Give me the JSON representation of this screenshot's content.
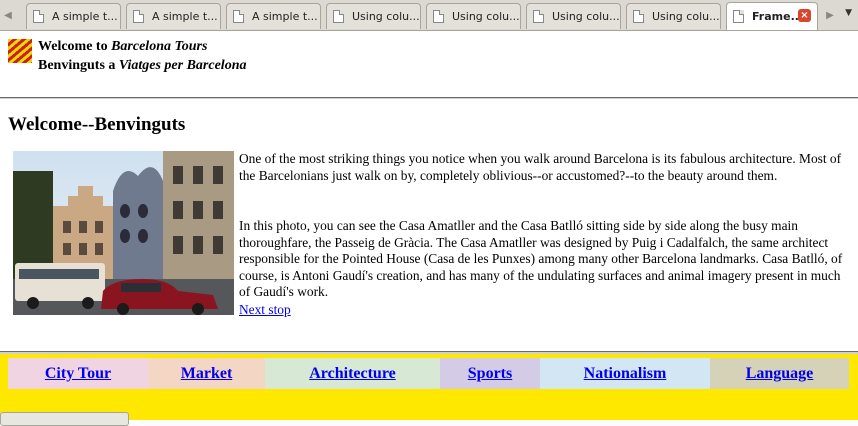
{
  "browser": {
    "tabs": [
      {
        "title": "A simple t...",
        "active": false
      },
      {
        "title": "A simple t...",
        "active": false
      },
      {
        "title": "A simple t...",
        "active": false
      },
      {
        "title": "Using colu...",
        "active": false
      },
      {
        "title": "Using colu...",
        "active": false
      },
      {
        "title": "Using colu...",
        "active": false
      },
      {
        "title": "Using colu...",
        "active": false
      },
      {
        "title": "Frame...",
        "active": true
      }
    ],
    "close_glyph": "×",
    "scroll_left_glyph": "◀",
    "scroll_right_glyph": "▶",
    "dropdown_glyph": "▼"
  },
  "header": {
    "line1_prefix": "Welcome to ",
    "line1_em": "Barcelona Tours",
    "line2_prefix": "Benvinguts a ",
    "line2_em": "Viatges per Barcelona"
  },
  "main": {
    "title": "Welcome--Benvinguts",
    "para1": "One of the most striking things you notice when you walk around Barcelona is its fabulous architecture. Most of the Barcelonians just walk on by, completely oblivious--or accustomed?--to the beauty around them.",
    "para2": "In this photo, you can see the Casa Amatller and the Casa Batlló sitting side by side along the busy main thoroughfare, the Passeig de Gràcia. The Casa Amatller was designed by Puig i Cadalfalch, the same architect responsible for the Pointed House (Casa de les Punxes) among many other Barcelona landmarks. Casa Batlló, of course, is Antoni Gaudí's creation, and has many of the undulating surfaces and animal imagery present in much of Gaudí's work.",
    "next_link": "Next stop"
  },
  "nav": {
    "items": [
      {
        "label": "City Tour",
        "color": "#f1d4e2"
      },
      {
        "label": "Market",
        "color": "#f3d6c4"
      },
      {
        "label": "Architecture",
        "color": "#d7e8d4"
      },
      {
        "label": "Sports",
        "color": "#d4cce6"
      },
      {
        "label": "Nationalism",
        "color": "#d3e6f4"
      },
      {
        "label": "Language",
        "color": "#d6d2b8"
      }
    ],
    "background": "#ffe800"
  }
}
